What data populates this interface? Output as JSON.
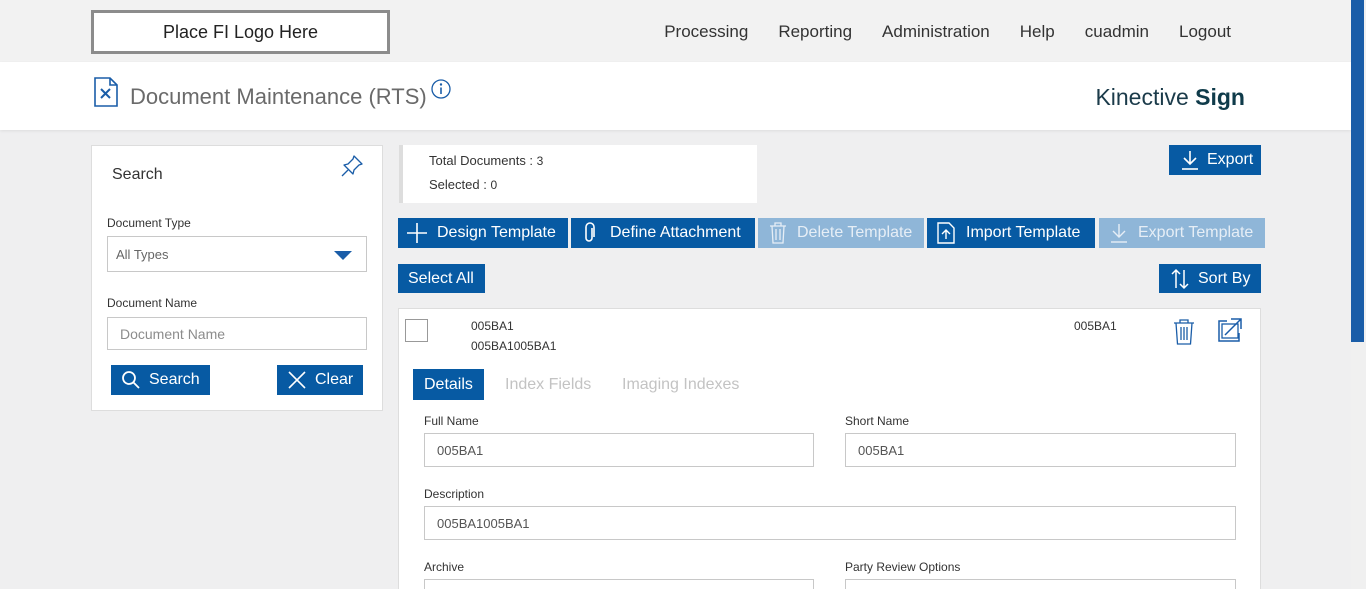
{
  "topbar": {
    "logo_text": "Place FI Logo Here",
    "nav": [
      "Processing",
      "Reporting",
      "Administration",
      "Help",
      "cuadmin",
      "Logout"
    ]
  },
  "header": {
    "title": "Document Maintenance (RTS)",
    "brand_light": "Kinective ",
    "brand_bold": "Sign"
  },
  "search": {
    "title": "Search",
    "doc_type_label": "Document Type",
    "doc_type_value": "All Types",
    "doc_name_label": "Document Name",
    "doc_name_placeholder": "Document Name",
    "search_label": "Search",
    "clear_label": "Clear"
  },
  "summary": {
    "total_label": "Total Documents : ",
    "total_value": "3",
    "selected_label": "Selected : ",
    "selected_value": "0"
  },
  "toolbar": {
    "export_label": "Export",
    "design_label": "Design Template",
    "attach_label": "Define Attachment",
    "delete_label": "Delete Template",
    "import_label": "Import Template",
    "export_template_label": "Export Template",
    "select_all_label": "Select All",
    "sort_label": "Sort By"
  },
  "document": {
    "code": "005BA1",
    "subtitle": "005BA1005BA1",
    "short_code": "005BA1",
    "tabs": [
      "Details",
      "Index Fields",
      "Imaging Indexes"
    ],
    "full_name_label": "Full Name",
    "full_name_value": "005BA1",
    "short_name_label": "Short Name",
    "short_name_value": "005BA1",
    "description_label": "Description",
    "description_value": "005BA1005BA1",
    "archive_label": "Archive",
    "party_review_label": "Party Review Options"
  },
  "colors": {
    "primary": "#075aa3",
    "disabled": "#8fb6d8",
    "brand_text": "#0f3b4a"
  }
}
